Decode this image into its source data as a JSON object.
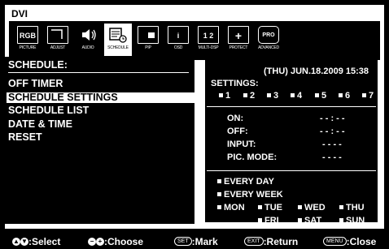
{
  "osd": {
    "source": "DVI",
    "tabs": [
      {
        "caption": "PICTURE",
        "icon": "picture-icon",
        "glyph": "RGB"
      },
      {
        "caption": "ADJUST",
        "icon": "adjust-icon",
        "glyph": ""
      },
      {
        "caption": "AUDIO",
        "icon": "speaker-icon",
        "glyph": "🔊"
      },
      {
        "caption": "SCHEDULE",
        "icon": "schedule-icon",
        "glyph": "▤"
      },
      {
        "caption": "PIP",
        "icon": "pip-icon",
        "glyph": ""
      },
      {
        "caption": "OSD",
        "icon": "info-icon",
        "glyph": "i"
      },
      {
        "caption": "MULTI-DSP",
        "icon": "multi-display-icon",
        "glyph": "1 2"
      },
      {
        "caption": "PROTECT",
        "icon": "protect-icon",
        "glyph": "+"
      },
      {
        "caption": "ADVANCED",
        "icon": "advanced-icon",
        "glyph": "PRO"
      }
    ],
    "active_tab": 3
  },
  "menu": {
    "title": "SCHEDULE:",
    "items": [
      "OFF TIMER",
      "SCHEDULE SETTINGS",
      "SCHEDULE LIST",
      "DATE & TIME",
      "RESET"
    ],
    "selected": 1
  },
  "details": {
    "datetime": "(THU) JUN.18.2009 15:38",
    "settings_label": "SETTINGS:",
    "slots": [
      "1",
      "2",
      "3",
      "4",
      "5",
      "6",
      "7"
    ],
    "on_label": "ON:",
    "on_value": "- - : - -",
    "off_label": "OFF:",
    "off_value": "- - : - -",
    "input_label": "INPUT:",
    "input_value": "- - - -",
    "picmode_label": "PIC. MODE:",
    "picmode_value": "- - - -",
    "every_day": "EVERY DAY",
    "every_week": "EVERY WEEK",
    "days": [
      "MON",
      "TUE",
      "WED",
      "THU",
      "FRI",
      "SAT",
      "SUN"
    ]
  },
  "footer": {
    "select": ":Select",
    "choose": ":Choose",
    "set_key": "SET",
    "mark": ":Mark",
    "exit_key": "EXIT",
    "return": ":Return",
    "menu_key": "MENU",
    "close": ":Close"
  }
}
